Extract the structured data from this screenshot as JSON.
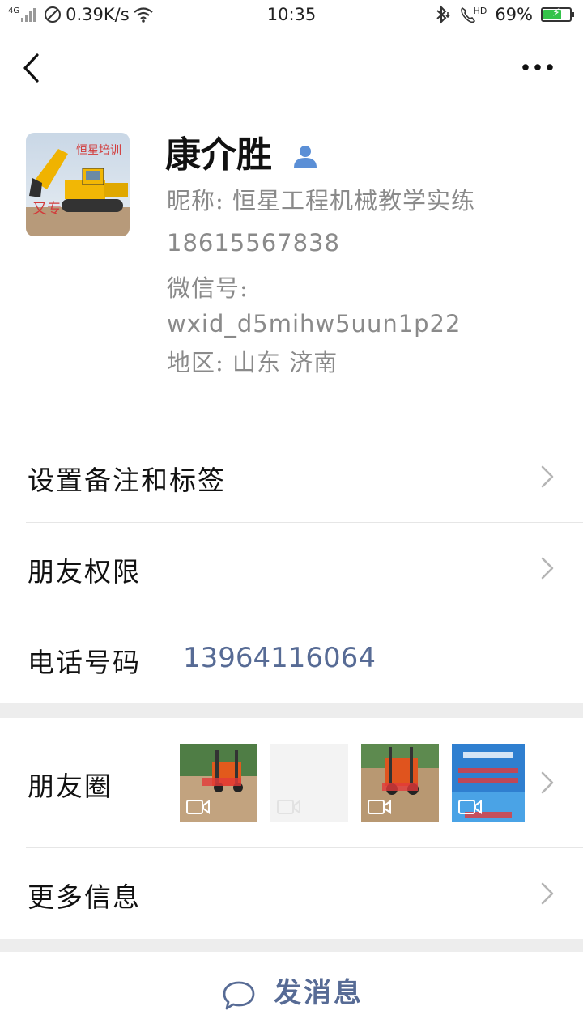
{
  "status_bar": {
    "network": "4G",
    "speed": "0.39K/s",
    "time": "10:35",
    "hd": "HD",
    "battery": "69%",
    "battery_level": 0.69
  },
  "profile": {
    "name": "康介胜",
    "nickname": "昵称: 恒星工程机械教学实练",
    "phone": "18615567838",
    "wechat_id_label": "微信号:",
    "wechat_id": "wxid_d5mihw5uun1p22",
    "region": "地区: 山东  济南"
  },
  "menu": {
    "remarks": "设置备注和标签",
    "permissions": "朋友权限",
    "phone_label": "电话号码",
    "phone_value": "13964116064",
    "moments": "朋友圈",
    "more_info": "更多信息"
  },
  "action": {
    "send_message": "发消息"
  },
  "colors": {
    "link": "#576b95",
    "gray_text": "#8a8a8a",
    "divider": "#e6e6e6",
    "section_gap": "#ededed"
  }
}
